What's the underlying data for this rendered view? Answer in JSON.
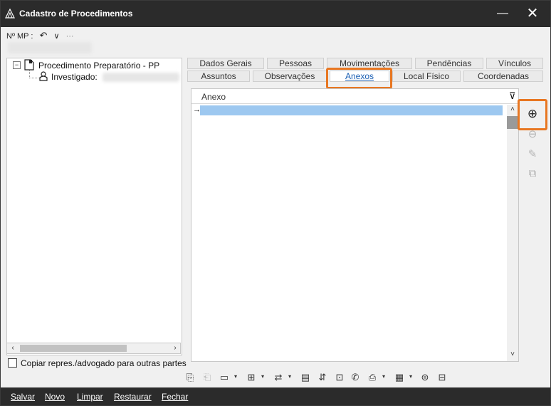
{
  "window": {
    "title": "Cadastro de Procedimentos",
    "minimize_glyph": "—",
    "close_glyph": "✕"
  },
  "mp_bar": {
    "label": "Nº MP :",
    "undo_glyph": "↶",
    "chevron_glyph": "∨",
    "more_glyph": "···"
  },
  "tree": {
    "toggle_glyph": "−",
    "root_label": "Procedimento Preparatório - PP",
    "child_label": "Investigado:",
    "scroll_left": "‹",
    "scroll_right": "›"
  },
  "copy_parties": {
    "label": "Copiar repres./advogado para outras partes"
  },
  "tabs": {
    "row1": [
      "Dados Gerais",
      "Pessoas",
      "Movimentações",
      "Pendências",
      "Vínculos"
    ],
    "row2": [
      "Assuntos",
      "Observações",
      "Anexos",
      "Local Físico",
      "Coordenadas"
    ],
    "active": "Anexos"
  },
  "grid": {
    "column_header": "Anexo",
    "filter_glyph": "⊽",
    "row_pointer": "→",
    "scroll_up": "˄",
    "scroll_down": "˅"
  },
  "side_buttons": {
    "add": "⊕",
    "remove": "⊖",
    "edit": "✎",
    "copy": "⧉"
  },
  "toolbar": {
    "icons": [
      "⎘",
      "⎗",
      "▭",
      "▾",
      "⊞",
      "▾",
      "⇄",
      "▾",
      "▤",
      "⇵",
      "⊡",
      "✆",
      "⎙",
      "▾",
      "▦",
      "▾",
      "⊜",
      "⊟"
    ]
  },
  "bottom_bar": {
    "save": "Salvar",
    "new": "Novo",
    "clear": "Limpar",
    "restore": "Restaurar",
    "close": "Fechar"
  },
  "colors": {
    "accent_highlight": "#e87722",
    "selected_row": "#9dc8f0",
    "title_bar": "#2b2b2b"
  }
}
